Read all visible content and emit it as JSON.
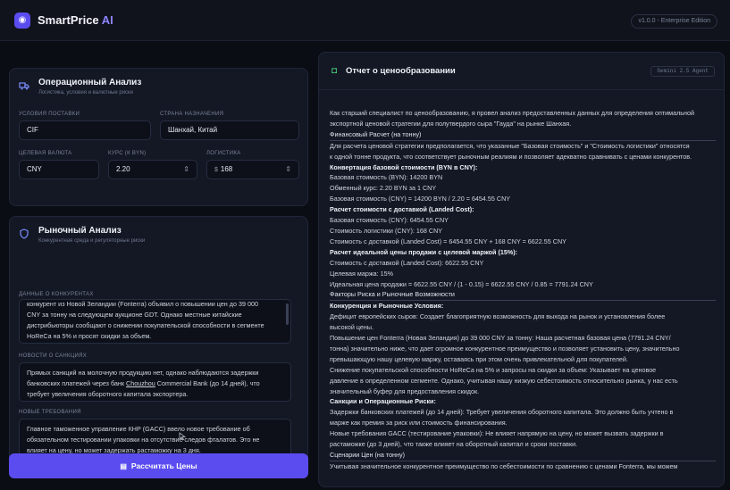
{
  "app": {
    "logo_glyph": "◉",
    "name": "SmartPrice",
    "name_suffix": "AI",
    "version": "v1.0.0 - Enterprise Edition"
  },
  "ops": {
    "title": "Операционный Анализ",
    "subtitle": "Логистика, условия и валютные риски",
    "delivery_label": "УСЛОВИЯ ПОСТАВКИ",
    "delivery_value": "CIF",
    "country_label": "СТРАНА НАЗНАЧЕНИЯ",
    "country_value": "Шанхай, Китай",
    "currency_label": "ЦЕЛЕВАЯ ВАЛЮТА",
    "currency_value": "CNY",
    "rate_label": "КУРС (К BYN)",
    "rate_value": "2.20",
    "logistics_label": "ЛОГИСТИКА",
    "logistics_currency": "$",
    "logistics_value": "168"
  },
  "market": {
    "title": "Рыночный Анализ",
    "subtitle": "Конкурентная среда и регуляторные риски",
    "competitors_label": "ДАННЫЕ О КОНКУРЕНТАХ",
    "competitors_lines": [
      "конкурент из Новой Зеландии (Fonterra) объявил о повышении цен до 39 000",
      "CNY за тонну на следующем аукционе GDT. Однако местные китайские",
      "дистрибьюторы сообщают о снижении покупательской способности в сегменте",
      "HoReCa на 5% и просят скидки за объем."
    ],
    "sanctions_label": "НОВОСТИ О САНКЦИЯХ",
    "sanctions_l1": "Прямых санкций на молочную продукцию нет, однако наблюдаются задержки",
    "sanctions_l2a": "банковских платежей через банк ",
    "sanctions_l2u": "Chouzhou",
    "sanctions_l2b": " Commercial Bank (до 14 дней), что",
    "sanctions_l3": "требует увеличения оборотного капитала экспортера.",
    "requirements_label": "НОВЫЕ ТРЕБОВАНИЯ",
    "requirements_l1": "Главное таможенное управление КНР (GACC) ввело новое требование об",
    "requirements_l2": "обязательном тестировании упаковки на отсутствие следов фталатов. Это не",
    "requirements_l3a": "влияет на цену, но может задержать ",
    "requirements_l3u": "растаможку",
    "requirements_l3b": " на 3 дня."
  },
  "calc_button": {
    "icon": "▤",
    "label": "Рассчитать Цены"
  },
  "report": {
    "icon": "◘",
    "title": "Отчет о ценообразовании",
    "badge": "Gemini 2.5 Agent",
    "intro": "Как старший специалист по ценообразованию, я провел анализ предоставленных данных для определения оптимальной экспортной ценовой стратегии для полутвердого сыра \"Гауда\" на рынке Шанхая.",
    "lines": [
      {
        "t": "Финансовый Расчет (на тонну)",
        "s": "sec"
      },
      {
        "t": "Для расчета ценовой стратегии предполагается, что указанные \"Базовая стоимость\" и \"Стоимость логистики\" относятся",
        "s": ""
      },
      {
        "t": "к одной тонне продукта, что соответствует рыночным реалиям и позволяет адекватно сравнивать с ценами конкурентов.",
        "s": ""
      },
      {
        "t": "Конвертация базовой стоимости (BYN в CNY):",
        "s": "b"
      },
      {
        "t": "Базовая стоимость (BYN): 14200 BYN",
        "s": ""
      },
      {
        "t": "Обменный курс: 2.20 BYN за 1 CNY",
        "s": ""
      },
      {
        "t": "Базовая стоимость (CNY) = 14200 BYN / 2.20 = 6454.55 CNY",
        "s": ""
      },
      {
        "t": "Расчет стоимости с доставкой (Landed Cost):",
        "s": "b"
      },
      {
        "t": "Базовая стоимость (CNY): 6454.55 CNY",
        "s": ""
      },
      {
        "t": "Стоимость логистики (CNY): 168 CNY",
        "s": ""
      },
      {
        "t": "Стоимость с доставкой (Landed Cost) = 6454.55 CNY + 168 CNY = 6622.55 CNY",
        "s": ""
      },
      {
        "t": "Расчет идеальной цены продажи с целевой маржой (15%):",
        "s": "b"
      },
      {
        "t": "Стоимость с доставкой (Landed Cost): 6622.55 CNY",
        "s": ""
      },
      {
        "t": "Целевая маржа: 15%",
        "s": ""
      },
      {
        "t": "Идеальная цена продажи = 6622.55 CNY / (1 - 0.15) = 6622.55 CNY / 0.85 = 7791.24 CNY",
        "s": ""
      },
      {
        "t": "Факторы Риска и Рыночные Возможности",
        "s": "sec"
      },
      {
        "t": "Конкуренция и Рыночные Условия:",
        "s": "b"
      },
      {
        "t": "Дефицит европейских сыров: Создает благоприятную возможность для выхода на рынок и установления более",
        "s": ""
      },
      {
        "t": "высокой цены.",
        "s": ""
      },
      {
        "t": "Повышение цен Fonterra (Новая Зеландия) до 39 000 CNY за тонну: Наша расчетная базовая цена (7791.24 CNY/",
        "s": ""
      },
      {
        "t": "тонна) значительно ниже, что дает огромное конкурентное преимущество и позволяет установить цену, значительно",
        "s": ""
      },
      {
        "t": "превышающую нашу целевую маржу, оставаясь при этом очень привлекательной для покупателей.",
        "s": ""
      },
      {
        "t": "Снижение покупательской способности HoReCa на 5% и запросы на скидки за объем: Указывает на ценовое",
        "s": ""
      },
      {
        "t": "давление в определенном сегменте. Однако, учитывая нашу низкую себестоимость относительно рынка, у нас есть",
        "s": ""
      },
      {
        "t": "значительный буфер для предоставления скидок.",
        "s": ""
      },
      {
        "t": "Санкции и Операционные Риски:",
        "s": "b"
      },
      {
        "t": "Задержки банковских платежей (до 14 дней): Требует увеличения оборотного капитала. Это должно быть учтено в",
        "s": ""
      },
      {
        "t": "марже как премия за риск или стоимость финансирования.",
        "s": ""
      },
      {
        "t": "Новые требования GACC (тестирование упаковки): Не влияет напрямую на цену, но может вызвать задержки в",
        "s": ""
      },
      {
        "t": "растаможке (до 3 дней), что также влияет на оборотный капитал и сроки поставки.",
        "s": ""
      },
      {
        "t": "Сценарии Цен (на тонну)",
        "s": "sec"
      },
      {
        "t": "Учитывая значительное конкурентное преимущество по себестоимости по сравнению с ценами Fonterra, мы можем",
        "s": ""
      }
    ]
  }
}
